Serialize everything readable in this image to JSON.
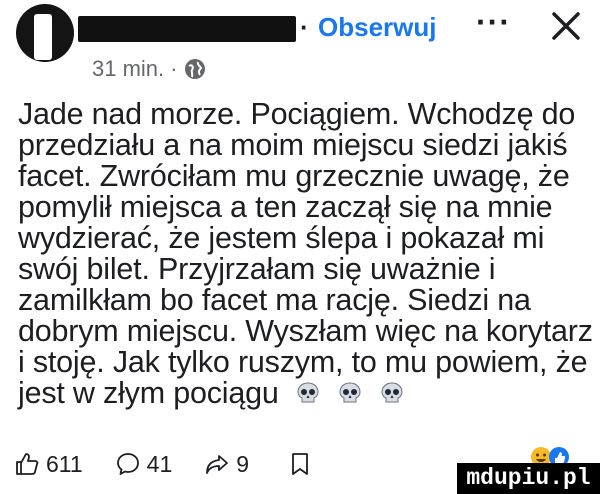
{
  "header": {
    "follow_label": "Obserwuj",
    "dot": "·",
    "more_label": "···",
    "timestamp": "31 min. ·"
  },
  "post": {
    "lines": [
      "Jade nad morze. Pociągiem. Wchodzę do",
      "przedziału a na moim miejscu siedzi jakiś",
      "facet. Zwróciłam mu grzecznie uwagę, że",
      "pomylił miejsca a ten zaczął się na mnie",
      "wydzierać, że jestem ślepa i pokazał mi",
      "swój bilet. Przyjrzałam się uważnie i",
      "zamilkłam bo facet ma rację. Siedzi na",
      "dobrym miejscu. Wyszłam więc na korytarz",
      "i stoję. Jak tylko ruszym, to mu powiem, że",
      "jest w złym pociągu"
    ],
    "emojis": [
      "skull",
      "skull",
      "skull"
    ]
  },
  "actions": {
    "likes": "611",
    "comments": "41",
    "shares": "9"
  },
  "watermark": "mdupiu.pl",
  "colors": {
    "link": "#1877f2",
    "text": "#1c1e21",
    "muted": "#65676b"
  }
}
